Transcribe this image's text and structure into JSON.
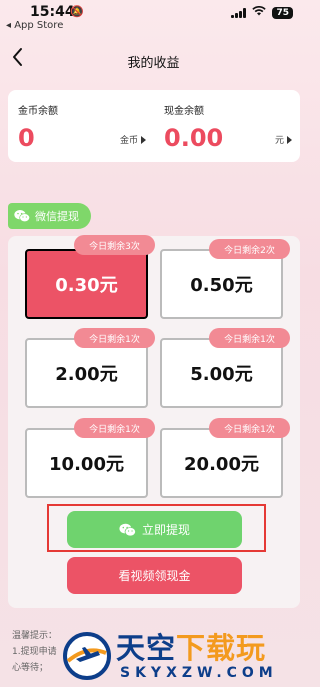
{
  "status_bar": {
    "time": "15:44",
    "back_app": "◂ App Store",
    "battery": "75"
  },
  "nav": {
    "title": "我的收益"
  },
  "balance": {
    "coins": {
      "label": "金币余额",
      "value": "0",
      "unit": "金币"
    },
    "cash": {
      "label": "现金余额",
      "value": "0.00",
      "unit": "元"
    }
  },
  "wechat_tab": {
    "label": "微信提现"
  },
  "options": [
    {
      "amount": "0.30元",
      "badge": "今日剩余3次",
      "selected": true
    },
    {
      "amount": "0.50元",
      "badge": "今日剩余2次",
      "selected": false
    },
    {
      "amount": "2.00元",
      "badge": "今日剩余1次",
      "selected": false
    },
    {
      "amount": "5.00元",
      "badge": "今日剩余1次",
      "selected": false
    },
    {
      "amount": "10.00元",
      "badge": "今日剩余1次",
      "selected": false
    },
    {
      "amount": "20.00元",
      "badge": "今日剩余1次",
      "selected": false
    }
  ],
  "buttons": {
    "withdraw": "立即提现",
    "watch_video": "看视频领现金"
  },
  "tips": {
    "line1": "温馨提示：",
    "line2": "1.提现申请",
    "line3": "心等待；"
  },
  "watermark": {
    "main_blue": "天空",
    "main_orange": "下载玩",
    "sub": "SKYXZW.COM"
  },
  "colors": {
    "accent_red": "#ec5366",
    "accent_green": "#6fd36e",
    "badge_pink": "#f28a94",
    "highlight_outline": "#e53935"
  }
}
